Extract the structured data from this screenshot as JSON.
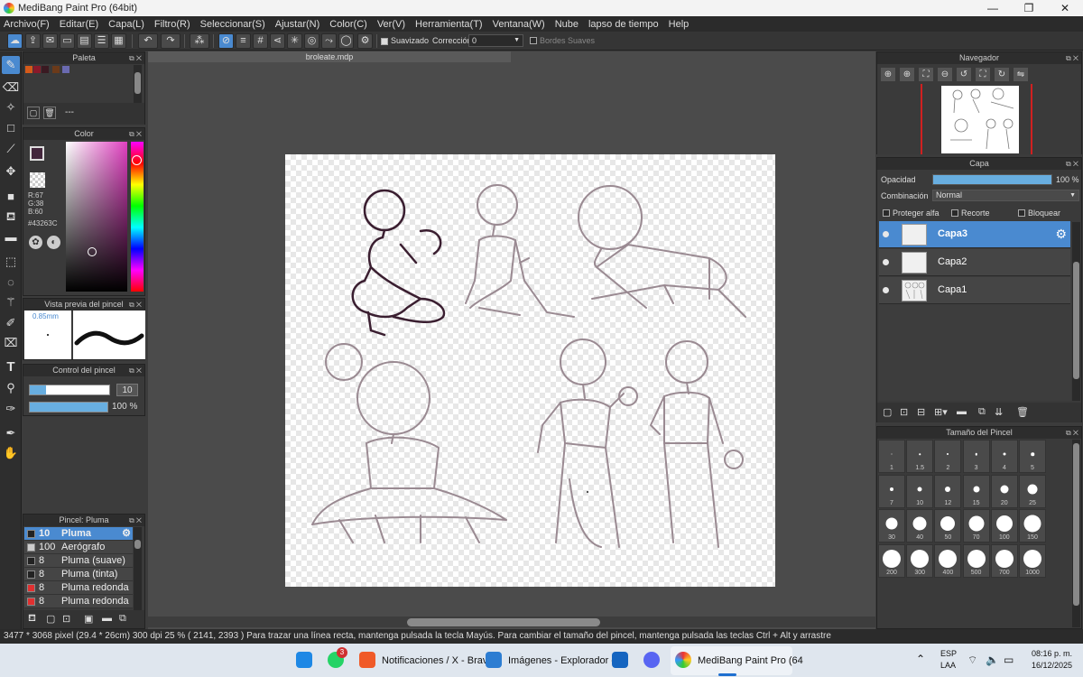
{
  "window": {
    "title": "MediBang Paint Pro (64bit)",
    "minimize": "—",
    "maximize": "❐",
    "close": "✕"
  },
  "menu": [
    "Archivo(F)",
    "Editar(E)",
    "Capa(L)",
    "Filtro(R)",
    "Seleccionar(S)",
    "Ajustar(N)",
    "Color(C)",
    "Ver(V)",
    "Herramienta(T)",
    "Ventana(W)",
    "Nube",
    "lapso de tiempo",
    "Help"
  ],
  "toolbar": {
    "smoothing_label": "Suavizado",
    "correction_label": "Corrección",
    "correction_value": "0",
    "soft_edges_label": "Bordes Suaves"
  },
  "palette": {
    "title": "Paleta",
    "name": "---",
    "swatches": [
      "#d45a1a",
      "#8a1a2a",
      "#3a1a22",
      "#6b3a1a",
      "#6a6ab0"
    ]
  },
  "color": {
    "title": "Color",
    "r_label": "R:67",
    "g_label": "G:38",
    "b_label": "B:60",
    "hex": "#43263C",
    "primary": "#43263C"
  },
  "brush_preview": {
    "title": "Vista previa del pincel",
    "size": "0.85mm"
  },
  "brush_control": {
    "title": "Control del pincel",
    "size_value": "10",
    "opacity_value": "100 %"
  },
  "brush_list": {
    "title": "Pincel: Pluma",
    "items": [
      {
        "size": "10",
        "name": "Pluma",
        "color": "#222222"
      },
      {
        "size": "100",
        "name": "Aerógrafo",
        "color": "#cccccc"
      },
      {
        "size": "8",
        "name": "Pluma (suave)",
        "color": "#222222"
      },
      {
        "size": "8",
        "name": "Pluma (tinta)",
        "color": "#222222"
      },
      {
        "size": "8",
        "name": "Pluma redonda",
        "color": "#e03030"
      },
      {
        "size": "8",
        "name": "Pluma redonda (s",
        "color": "#e03030"
      }
    ]
  },
  "document": {
    "tab": "broleate.mdp"
  },
  "navigator": {
    "title": "Navegador"
  },
  "layers": {
    "title": "Capa",
    "opacity_label": "Opacidad",
    "opacity_value": "100 %",
    "opacity_fraction": 1.0,
    "blend_label": "Combinación",
    "blend_value": "Normal",
    "protect_alpha": "Proteger alfa",
    "clipping": "Recorte",
    "lock": "Bloquear",
    "items": [
      {
        "name": "Capa3",
        "selected": true
      },
      {
        "name": "Capa2",
        "selected": false
      },
      {
        "name": "Capa1",
        "selected": false
      }
    ]
  },
  "brush_size": {
    "title": "Tamaño del Pincel",
    "sizes": [
      "1",
      "1.5",
      "2",
      "3",
      "4",
      "5",
      "7",
      "10",
      "12",
      "15",
      "20",
      "25",
      "30",
      "40",
      "50",
      "70",
      "100",
      "150",
      "200",
      "300",
      "400",
      "500",
      "700",
      "1000"
    ]
  },
  "status": {
    "text": "3477 * 3068 pixel   (29.4 * 26cm)   300 dpi   25 %   ( 2141, 2393 )   Para trazar una línea recta, mantenga pulsada la tecla Mayús. Para cambiar el tamaño del pincel, mantenga pulsada las teclas Ctrl + Alt y arrastre"
  },
  "taskbar": {
    "whatsapp_badge": "3",
    "brave_label": "Notificaciones / X - Brav",
    "explorer_label": "Imágenes - Explorador d",
    "medibang_label": "MediBang Paint Pro (64",
    "lang_top": "ESP",
    "lang_bottom": "LAA",
    "time": "08:16 p. m.",
    "date": "16/12/2025"
  }
}
